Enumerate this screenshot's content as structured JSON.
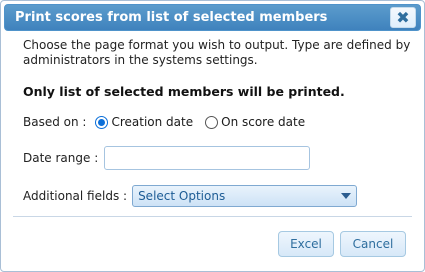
{
  "dialog": {
    "title": "Print scores from list of selected members",
    "close_icon_char": "✖",
    "intro_text": "Choose the page format you wish to output. Type are defined by administrators in the systems settings.",
    "notice_text": "Only list of selected members will be printed.",
    "based_on": {
      "label": "Based on :",
      "options": [
        {
          "label": "Creation date",
          "checked": true
        },
        {
          "label": "On score date",
          "checked": false
        }
      ]
    },
    "date_range": {
      "label": "Date range :",
      "value": ""
    },
    "additional_fields": {
      "label": "Additional fields :",
      "selected": "Select Options"
    },
    "buttons": {
      "excel": "Excel",
      "cancel": "Cancel"
    }
  }
}
